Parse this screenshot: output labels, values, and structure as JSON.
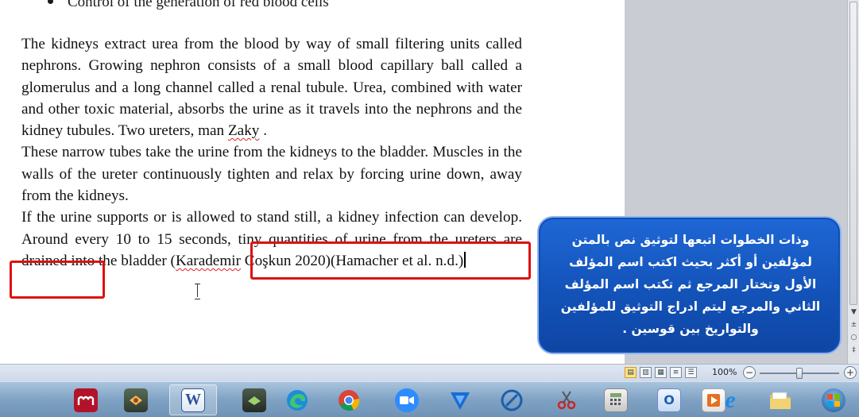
{
  "document": {
    "bullet": "Control of the generation of red blood cells",
    "para1_before": "The kidneys extract urea from the blood by way of small filtering units called nephrons. Growing nephron consists of a small blood capillary ball called a glomerulus and a long channel called a renal tubule. Urea, combined with water and other toxic material, absorbs the urine as it travels into the nephrons and the kidney tubules. Two ureters, man ",
    "para1_misspelled": "Zaky",
    "para1_after": " .",
    "para2": " These narrow tubes take the urine from the kidneys to the bladder. Muscles in the walls of the ureter continuously tighten and relax by forcing urine down, away from the kidneys.",
    "para3_before": " If the urine supports or is allowed to stand still, a kidney infection can develop. Around every 10 to 15 seconds, tiny quantities of urine from the ureters are drained into the bladder ",
    "citation_open": "(",
    "citation_author": "Karademir",
    "citation_rest": " Coşkun 2020)(Hamacher et al. n.d.)"
  },
  "callout": {
    "text": "وذات الخطوات اتبعها لتوثيق نص بالمتن لمؤلفين أو أكثر بحيث اكتب اسم المؤلف الأول وتختار المرجع ثم تكتب اسم المؤلف الثاني والمرجع ليتم ادراج التوثيق للمؤلفين والتواريخ بين قوسين ."
  },
  "statusbar": {
    "zoom_level": "100%",
    "zoom_percent": 100,
    "zoom_minus": "−",
    "zoom_plus": "+"
  },
  "taskbar": {
    "items": [
      {
        "name": "mendeley",
        "glyph": "m"
      },
      {
        "name": "app-2",
        "glyph": ""
      },
      {
        "name": "word",
        "glyph": "W"
      },
      {
        "name": "app-4",
        "glyph": ""
      },
      {
        "name": "edge",
        "glyph": ""
      },
      {
        "name": "chrome",
        "glyph": ""
      },
      {
        "name": "zoom",
        "glyph": ""
      },
      {
        "name": "app-8",
        "glyph": ""
      },
      {
        "name": "app-9",
        "glyph": ""
      },
      {
        "name": "snipping-tool",
        "glyph": ""
      },
      {
        "name": "calculator",
        "glyph": ""
      },
      {
        "name": "outlook",
        "glyph": ""
      },
      {
        "name": "media-player",
        "glyph": ""
      },
      {
        "name": "internet-explorer",
        "glyph": "e"
      },
      {
        "name": "file-explorer",
        "glyph": ""
      },
      {
        "name": "start",
        "glyph": ""
      }
    ]
  },
  "colors": {
    "highlight_box": "#dd1111",
    "callout_bg": "#1353b9",
    "spellcheck": "#e02020"
  }
}
